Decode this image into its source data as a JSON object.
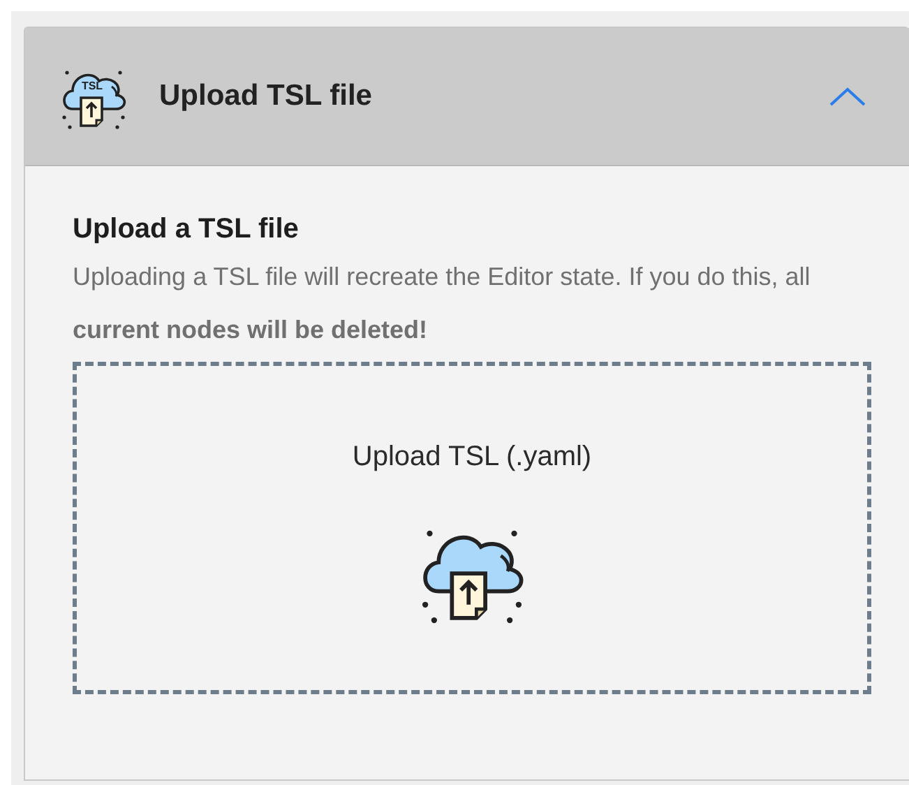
{
  "panel": {
    "title": "Upload TSL file",
    "icon_text": "TSL",
    "expanded": true
  },
  "section": {
    "heading": "Upload a TSL file",
    "description": "Uploading a TSL file will recreate the Editor state. If you do this, all **current nodes will be deleted!**"
  },
  "dropzone": {
    "label": "Upload TSL (.yaml)"
  }
}
